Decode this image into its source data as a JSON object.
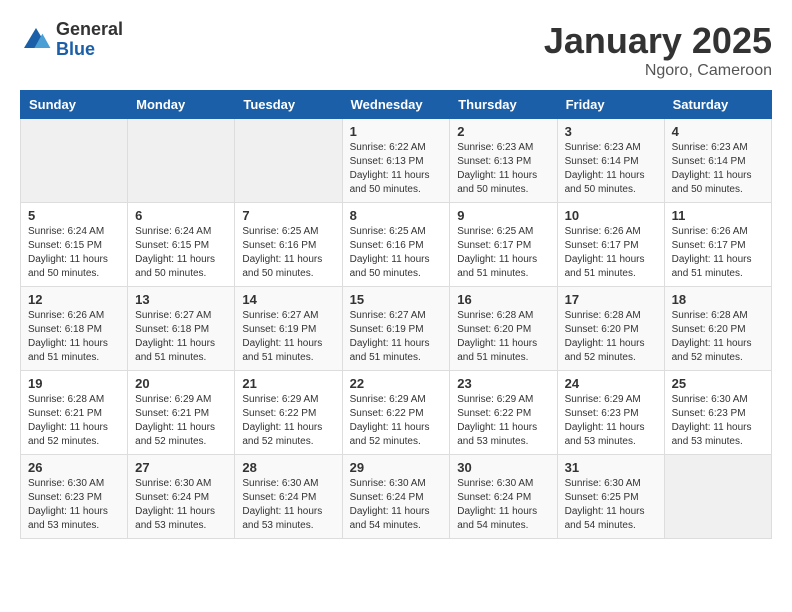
{
  "logo": {
    "general": "General",
    "blue": "Blue"
  },
  "title": "January 2025",
  "subtitle": "Ngoro, Cameroon",
  "weekdays": [
    "Sunday",
    "Monday",
    "Tuesday",
    "Wednesday",
    "Thursday",
    "Friday",
    "Saturday"
  ],
  "weeks": [
    [
      {
        "day": "",
        "info": ""
      },
      {
        "day": "",
        "info": ""
      },
      {
        "day": "",
        "info": ""
      },
      {
        "day": "1",
        "info": "Sunrise: 6:22 AM\nSunset: 6:13 PM\nDaylight: 11 hours\nand 50 minutes."
      },
      {
        "day": "2",
        "info": "Sunrise: 6:23 AM\nSunset: 6:13 PM\nDaylight: 11 hours\nand 50 minutes."
      },
      {
        "day": "3",
        "info": "Sunrise: 6:23 AM\nSunset: 6:14 PM\nDaylight: 11 hours\nand 50 minutes."
      },
      {
        "day": "4",
        "info": "Sunrise: 6:23 AM\nSunset: 6:14 PM\nDaylight: 11 hours\nand 50 minutes."
      }
    ],
    [
      {
        "day": "5",
        "info": "Sunrise: 6:24 AM\nSunset: 6:15 PM\nDaylight: 11 hours\nand 50 minutes."
      },
      {
        "day": "6",
        "info": "Sunrise: 6:24 AM\nSunset: 6:15 PM\nDaylight: 11 hours\nand 50 minutes."
      },
      {
        "day": "7",
        "info": "Sunrise: 6:25 AM\nSunset: 6:16 PM\nDaylight: 11 hours\nand 50 minutes."
      },
      {
        "day": "8",
        "info": "Sunrise: 6:25 AM\nSunset: 6:16 PM\nDaylight: 11 hours\nand 50 minutes."
      },
      {
        "day": "9",
        "info": "Sunrise: 6:25 AM\nSunset: 6:17 PM\nDaylight: 11 hours\nand 51 minutes."
      },
      {
        "day": "10",
        "info": "Sunrise: 6:26 AM\nSunset: 6:17 PM\nDaylight: 11 hours\nand 51 minutes."
      },
      {
        "day": "11",
        "info": "Sunrise: 6:26 AM\nSunset: 6:17 PM\nDaylight: 11 hours\nand 51 minutes."
      }
    ],
    [
      {
        "day": "12",
        "info": "Sunrise: 6:26 AM\nSunset: 6:18 PM\nDaylight: 11 hours\nand 51 minutes."
      },
      {
        "day": "13",
        "info": "Sunrise: 6:27 AM\nSunset: 6:18 PM\nDaylight: 11 hours\nand 51 minutes."
      },
      {
        "day": "14",
        "info": "Sunrise: 6:27 AM\nSunset: 6:19 PM\nDaylight: 11 hours\nand 51 minutes."
      },
      {
        "day": "15",
        "info": "Sunrise: 6:27 AM\nSunset: 6:19 PM\nDaylight: 11 hours\nand 51 minutes."
      },
      {
        "day": "16",
        "info": "Sunrise: 6:28 AM\nSunset: 6:20 PM\nDaylight: 11 hours\nand 51 minutes."
      },
      {
        "day": "17",
        "info": "Sunrise: 6:28 AM\nSunset: 6:20 PM\nDaylight: 11 hours\nand 52 minutes."
      },
      {
        "day": "18",
        "info": "Sunrise: 6:28 AM\nSunset: 6:20 PM\nDaylight: 11 hours\nand 52 minutes."
      }
    ],
    [
      {
        "day": "19",
        "info": "Sunrise: 6:28 AM\nSunset: 6:21 PM\nDaylight: 11 hours\nand 52 minutes."
      },
      {
        "day": "20",
        "info": "Sunrise: 6:29 AM\nSunset: 6:21 PM\nDaylight: 11 hours\nand 52 minutes."
      },
      {
        "day": "21",
        "info": "Sunrise: 6:29 AM\nSunset: 6:22 PM\nDaylight: 11 hours\nand 52 minutes."
      },
      {
        "day": "22",
        "info": "Sunrise: 6:29 AM\nSunset: 6:22 PM\nDaylight: 11 hours\nand 52 minutes."
      },
      {
        "day": "23",
        "info": "Sunrise: 6:29 AM\nSunset: 6:22 PM\nDaylight: 11 hours\nand 53 minutes."
      },
      {
        "day": "24",
        "info": "Sunrise: 6:29 AM\nSunset: 6:23 PM\nDaylight: 11 hours\nand 53 minutes."
      },
      {
        "day": "25",
        "info": "Sunrise: 6:30 AM\nSunset: 6:23 PM\nDaylight: 11 hours\nand 53 minutes."
      }
    ],
    [
      {
        "day": "26",
        "info": "Sunrise: 6:30 AM\nSunset: 6:23 PM\nDaylight: 11 hours\nand 53 minutes."
      },
      {
        "day": "27",
        "info": "Sunrise: 6:30 AM\nSunset: 6:24 PM\nDaylight: 11 hours\nand 53 minutes."
      },
      {
        "day": "28",
        "info": "Sunrise: 6:30 AM\nSunset: 6:24 PM\nDaylight: 11 hours\nand 53 minutes."
      },
      {
        "day": "29",
        "info": "Sunrise: 6:30 AM\nSunset: 6:24 PM\nDaylight: 11 hours\nand 54 minutes."
      },
      {
        "day": "30",
        "info": "Sunrise: 6:30 AM\nSunset: 6:24 PM\nDaylight: 11 hours\nand 54 minutes."
      },
      {
        "day": "31",
        "info": "Sunrise: 6:30 AM\nSunset: 6:25 PM\nDaylight: 11 hours\nand 54 minutes."
      },
      {
        "day": "",
        "info": ""
      }
    ]
  ]
}
